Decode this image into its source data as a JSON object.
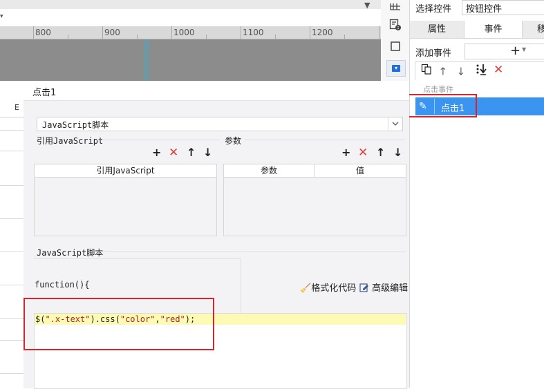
{
  "ruler": {
    "ticks": [
      "800",
      "900",
      "1000",
      "1100",
      "1200"
    ]
  },
  "sheet": {
    "column_label": "E"
  },
  "right_panel": {
    "select_label": "选择控件",
    "select_value": "按钮控件",
    "tabs": [
      "属性",
      "事件",
      "移"
    ],
    "add_event_label": "添加事件",
    "add_event_symbol": "+",
    "event_group_label": "点击事件",
    "event_item": "点击1"
  },
  "dialog": {
    "title": "点击1",
    "language": "JavaScript脚本",
    "ref_js_section": "引用JavaScript",
    "params_section": "参数",
    "ref_js_column": "引用JavaScript",
    "params_columns": [
      "参数",
      "值"
    ],
    "script_section": "JavaScript脚本",
    "function_header": "function(){",
    "code_prefix": "$(",
    "code_arg1": "\".x-text\"",
    "code_mid": ").css(",
    "code_arg2": "\"color\"",
    "code_comma": ",",
    "code_arg3": "\"red\"",
    "code_suffix": ");",
    "format_code": "格式化代码",
    "advanced_edit": "高级编辑"
  },
  "colors": {
    "accent": "#3b95f0",
    "highlight": "#d9232d",
    "delete": "#e33b3b"
  }
}
